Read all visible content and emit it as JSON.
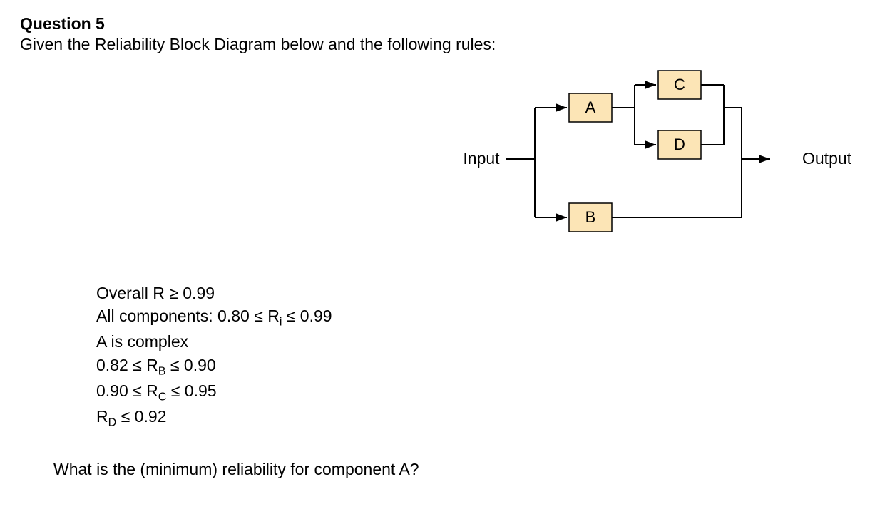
{
  "title": "Question 5",
  "intro": "Given the Reliability Block Diagram below and the following rules:",
  "diagram": {
    "input": "Input",
    "output": "Output",
    "blocks": {
      "A": "A",
      "B": "B",
      "C": "C",
      "D": "D"
    }
  },
  "rules": {
    "line1_pre": "Overall R ",
    "line1_post": " 0.99",
    "line2_pre": "All components: 0.80 ",
    "line2_mid": " R",
    "line2_sub": "i",
    "line2_post": " 0.99",
    "line3": "A is complex",
    "line4_pre": "0.82 ",
    "line4_mid": " R",
    "line4_sub": "B",
    "line4_post": " 0.90",
    "line5_pre": "0.90 ",
    "line5_mid": " R",
    "line5_sub": "C",
    "line5_post": " 0.95",
    "line6_pre": "R",
    "line6_sub": "D",
    "line6_post": " 0.92",
    "leq": "≤",
    "geq": "≥"
  },
  "final_question": "What is the (minimum) reliability for component A?"
}
